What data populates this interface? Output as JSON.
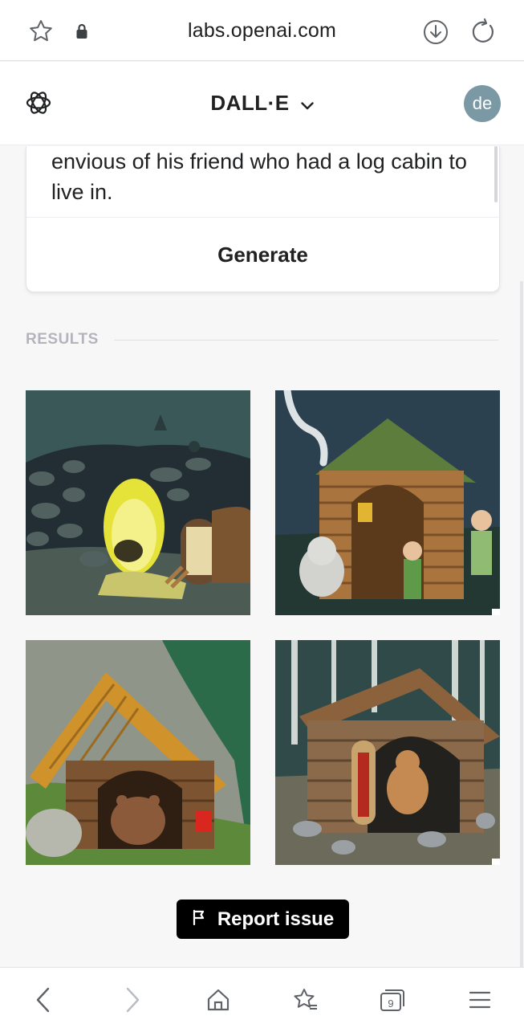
{
  "browser": {
    "url": "labs.openai.com",
    "tab_count": "9"
  },
  "header": {
    "title": "DALL·E",
    "avatar_initials": "de"
  },
  "prompt": {
    "text": "envious of his friend who had a log cabin to live in.",
    "generate_label": "Generate"
  },
  "results": {
    "label": "RESULTS"
  },
  "report_label": "Report issue",
  "colors": {
    "avatar": "#7a99a5",
    "brand_text": "#202123",
    "results_label": "#b4b4bd"
  },
  "icons": {
    "url_bar": [
      "star-icon",
      "lock-icon",
      "download-icon",
      "reload-icon"
    ],
    "header": [
      "openai-logo-icon",
      "chevron-down-icon"
    ],
    "bottom_nav": [
      "back-icon",
      "forward-icon",
      "home-icon",
      "favorites-icon",
      "tabs-icon",
      "menu-icon"
    ],
    "report": "flag-icon"
  }
}
